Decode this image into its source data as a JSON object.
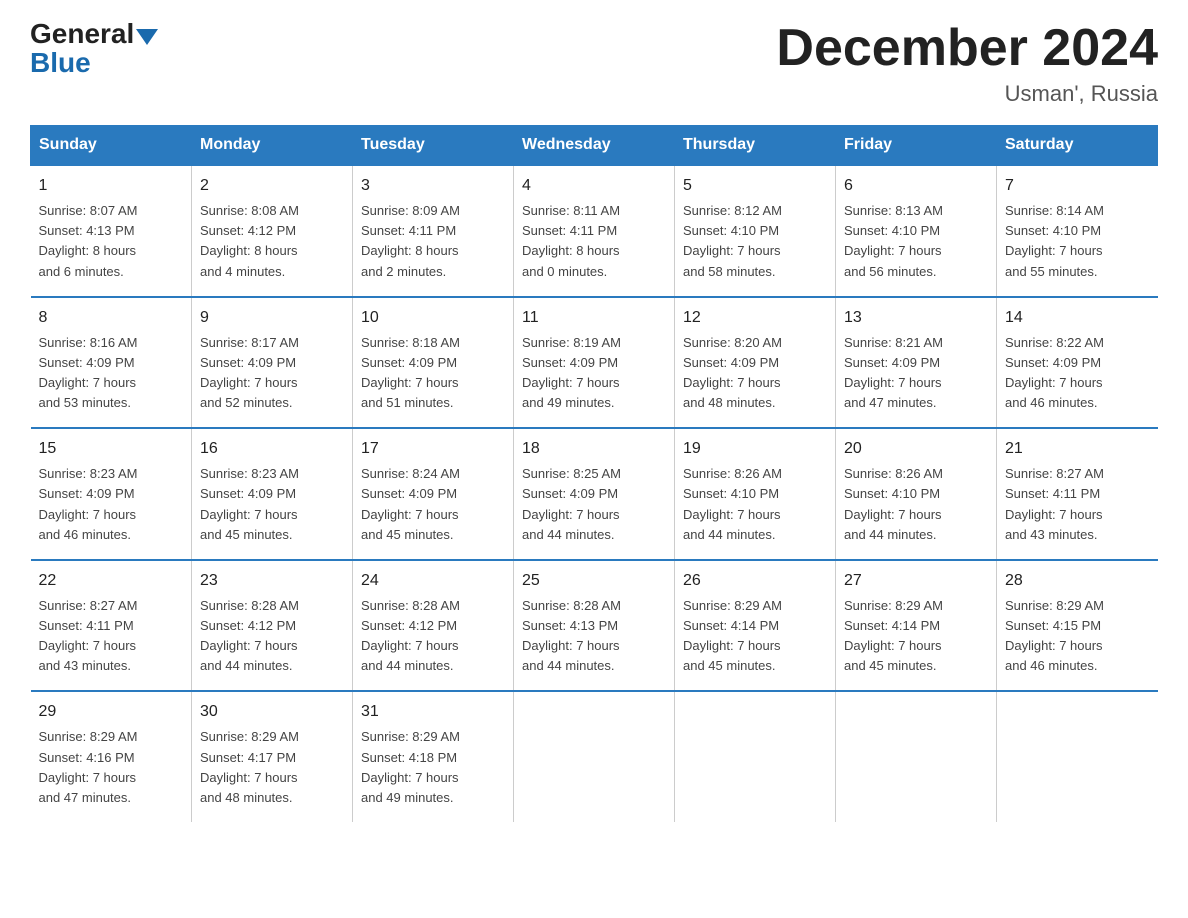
{
  "header": {
    "logo_general": "General",
    "logo_blue": "Blue",
    "title": "December 2024",
    "subtitle": "Usman', Russia"
  },
  "days_of_week": [
    "Sunday",
    "Monday",
    "Tuesday",
    "Wednesday",
    "Thursday",
    "Friday",
    "Saturday"
  ],
  "weeks": [
    [
      {
        "num": "1",
        "info": "Sunrise: 8:07 AM\nSunset: 4:13 PM\nDaylight: 8 hours\nand 6 minutes."
      },
      {
        "num": "2",
        "info": "Sunrise: 8:08 AM\nSunset: 4:12 PM\nDaylight: 8 hours\nand 4 minutes."
      },
      {
        "num": "3",
        "info": "Sunrise: 8:09 AM\nSunset: 4:11 PM\nDaylight: 8 hours\nand 2 minutes."
      },
      {
        "num": "4",
        "info": "Sunrise: 8:11 AM\nSunset: 4:11 PM\nDaylight: 8 hours\nand 0 minutes."
      },
      {
        "num": "5",
        "info": "Sunrise: 8:12 AM\nSunset: 4:10 PM\nDaylight: 7 hours\nand 58 minutes."
      },
      {
        "num": "6",
        "info": "Sunrise: 8:13 AM\nSunset: 4:10 PM\nDaylight: 7 hours\nand 56 minutes."
      },
      {
        "num": "7",
        "info": "Sunrise: 8:14 AM\nSunset: 4:10 PM\nDaylight: 7 hours\nand 55 minutes."
      }
    ],
    [
      {
        "num": "8",
        "info": "Sunrise: 8:16 AM\nSunset: 4:09 PM\nDaylight: 7 hours\nand 53 minutes."
      },
      {
        "num": "9",
        "info": "Sunrise: 8:17 AM\nSunset: 4:09 PM\nDaylight: 7 hours\nand 52 minutes."
      },
      {
        "num": "10",
        "info": "Sunrise: 8:18 AM\nSunset: 4:09 PM\nDaylight: 7 hours\nand 51 minutes."
      },
      {
        "num": "11",
        "info": "Sunrise: 8:19 AM\nSunset: 4:09 PM\nDaylight: 7 hours\nand 49 minutes."
      },
      {
        "num": "12",
        "info": "Sunrise: 8:20 AM\nSunset: 4:09 PM\nDaylight: 7 hours\nand 48 minutes."
      },
      {
        "num": "13",
        "info": "Sunrise: 8:21 AM\nSunset: 4:09 PM\nDaylight: 7 hours\nand 47 minutes."
      },
      {
        "num": "14",
        "info": "Sunrise: 8:22 AM\nSunset: 4:09 PM\nDaylight: 7 hours\nand 46 minutes."
      }
    ],
    [
      {
        "num": "15",
        "info": "Sunrise: 8:23 AM\nSunset: 4:09 PM\nDaylight: 7 hours\nand 46 minutes."
      },
      {
        "num": "16",
        "info": "Sunrise: 8:23 AM\nSunset: 4:09 PM\nDaylight: 7 hours\nand 45 minutes."
      },
      {
        "num": "17",
        "info": "Sunrise: 8:24 AM\nSunset: 4:09 PM\nDaylight: 7 hours\nand 45 minutes."
      },
      {
        "num": "18",
        "info": "Sunrise: 8:25 AM\nSunset: 4:09 PM\nDaylight: 7 hours\nand 44 minutes."
      },
      {
        "num": "19",
        "info": "Sunrise: 8:26 AM\nSunset: 4:10 PM\nDaylight: 7 hours\nand 44 minutes."
      },
      {
        "num": "20",
        "info": "Sunrise: 8:26 AM\nSunset: 4:10 PM\nDaylight: 7 hours\nand 44 minutes."
      },
      {
        "num": "21",
        "info": "Sunrise: 8:27 AM\nSunset: 4:11 PM\nDaylight: 7 hours\nand 43 minutes."
      }
    ],
    [
      {
        "num": "22",
        "info": "Sunrise: 8:27 AM\nSunset: 4:11 PM\nDaylight: 7 hours\nand 43 minutes."
      },
      {
        "num": "23",
        "info": "Sunrise: 8:28 AM\nSunset: 4:12 PM\nDaylight: 7 hours\nand 44 minutes."
      },
      {
        "num": "24",
        "info": "Sunrise: 8:28 AM\nSunset: 4:12 PM\nDaylight: 7 hours\nand 44 minutes."
      },
      {
        "num": "25",
        "info": "Sunrise: 8:28 AM\nSunset: 4:13 PM\nDaylight: 7 hours\nand 44 minutes."
      },
      {
        "num": "26",
        "info": "Sunrise: 8:29 AM\nSunset: 4:14 PM\nDaylight: 7 hours\nand 45 minutes."
      },
      {
        "num": "27",
        "info": "Sunrise: 8:29 AM\nSunset: 4:14 PM\nDaylight: 7 hours\nand 45 minutes."
      },
      {
        "num": "28",
        "info": "Sunrise: 8:29 AM\nSunset: 4:15 PM\nDaylight: 7 hours\nand 46 minutes."
      }
    ],
    [
      {
        "num": "29",
        "info": "Sunrise: 8:29 AM\nSunset: 4:16 PM\nDaylight: 7 hours\nand 47 minutes."
      },
      {
        "num": "30",
        "info": "Sunrise: 8:29 AM\nSunset: 4:17 PM\nDaylight: 7 hours\nand 48 minutes."
      },
      {
        "num": "31",
        "info": "Sunrise: 8:29 AM\nSunset: 4:18 PM\nDaylight: 7 hours\nand 49 minutes."
      },
      {
        "num": "",
        "info": ""
      },
      {
        "num": "",
        "info": ""
      },
      {
        "num": "",
        "info": ""
      },
      {
        "num": "",
        "info": ""
      }
    ]
  ]
}
